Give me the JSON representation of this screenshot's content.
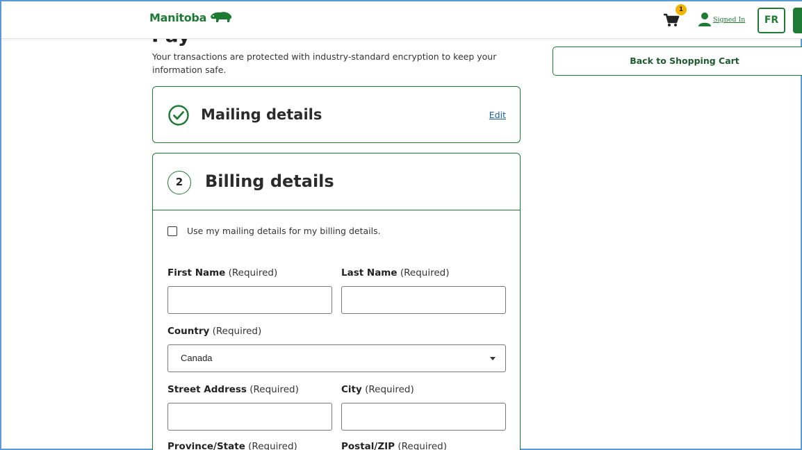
{
  "header": {
    "logo_text": "Manitoba",
    "cart_count": "1",
    "signed_in_label": "Signed In",
    "language_button": "FR"
  },
  "intro": {
    "heading_partial": "Pay",
    "text": "Your transactions are protected with industry-standard encryption to keep your information safe."
  },
  "mailing": {
    "title": "Mailing details",
    "edit_label": "Edit"
  },
  "billing": {
    "step_number": "2",
    "title": "Billing details",
    "use_mailing_label": "Use my mailing details for my billing details.",
    "use_mailing_checked": false,
    "required_suffix": "(Required)",
    "fields": {
      "first_name": {
        "label": "First Name",
        "value": ""
      },
      "last_name": {
        "label": "Last Name",
        "value": ""
      },
      "country": {
        "label": "Country",
        "value": "Canada"
      },
      "street_address": {
        "label": "Street Address",
        "value": ""
      },
      "city": {
        "label": "City",
        "value": ""
      },
      "province_state": {
        "label": "Province/State"
      },
      "postal_zip": {
        "label": "Postal/ZIP"
      }
    }
  },
  "sidebar": {
    "back_to_cart_label": "Back to Shopping Cart"
  },
  "colors": {
    "brand_green": "#1f7a34",
    "link_blue": "#1a5f9e",
    "badge_yellow": "#f5b400"
  }
}
